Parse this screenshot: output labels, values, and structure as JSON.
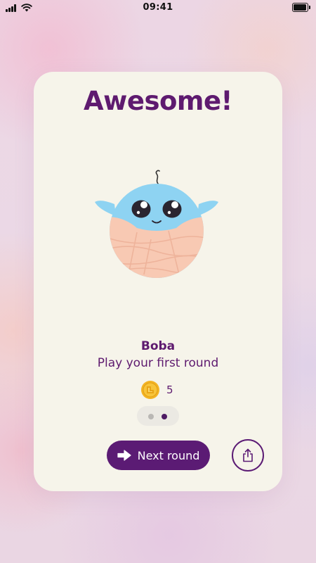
{
  "status_bar": {
    "time": "09:41"
  },
  "card": {
    "title": "Awesome!",
    "pet_name": "Boba",
    "achievement": "Play your first round",
    "reward": {
      "icon": "coin-icon",
      "count": "5"
    },
    "pager": {
      "total": 2,
      "active": 2
    },
    "next_button_label": "Next round",
    "share_icon": "share-icon"
  },
  "colors": {
    "primary": "#5b1b74",
    "title": "#5e1a6f",
    "card_bg": "#f6f4ea",
    "mascot_blue": "#8ed3f2",
    "mascot_peach": "#f8c9b3",
    "coin": "#f3b424"
  }
}
